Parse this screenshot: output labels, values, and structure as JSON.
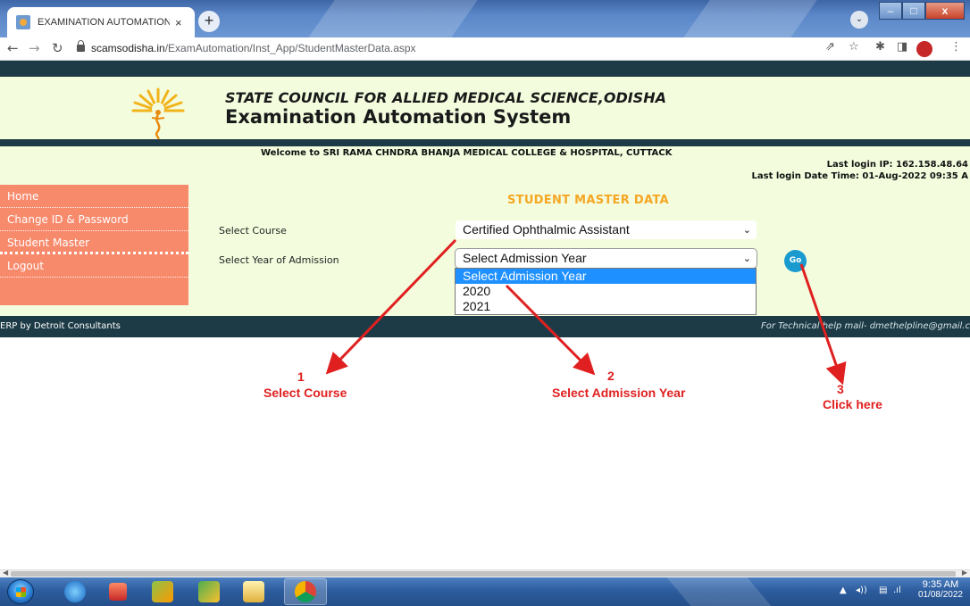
{
  "browser": {
    "tab_title": "EXAMINATION AUTOMATION SY",
    "tab_close": "×",
    "new_tab": "+",
    "url_host": "scamsodisha.in",
    "url_path": "/ExamAutomation/Inst_App/StudentMasterData.aspx"
  },
  "header": {
    "council": "STATE COUNCIL FOR ALLIED MEDICAL SCIENCE,ODISHA",
    "system": "Examination Automation System"
  },
  "welcome": {
    "text": "Welcome to  SRI RAMA CHNDRA BHANJA MEDICAL COLLEGE & HOSPITAL, CUTTACK",
    "last_ip": "Last login IP:  162.158.48.64",
    "last_datetime": "Last login Date Time: 01-Aug-2022 09:35 A"
  },
  "menu": {
    "items": [
      {
        "label": "Home"
      },
      {
        "label": "Change ID & Password"
      },
      {
        "label": "Student Master"
      },
      {
        "label": "Logout"
      }
    ]
  },
  "form": {
    "title": "STUDENT MASTER DATA",
    "course_label": "Select Course",
    "course_value": "Certified Ophthalmic Assistant",
    "year_label": "Select Year of Admission",
    "year_value": "Select Admission Year",
    "year_options": [
      "Select Admission Year",
      "2020",
      "2021"
    ],
    "go_label": "Go"
  },
  "footer": {
    "left": "ERP by Detroit Consultants",
    "right": "For Technical help mail- dmethelpline@gmail.c"
  },
  "annotations": [
    {
      "number": "1",
      "label": "Select Course"
    },
    {
      "number": "2",
      "label": "Select Admission Year"
    },
    {
      "number": "3",
      "label": "Click here"
    }
  ],
  "taskbar": {
    "time": "9:35 AM",
    "date": "01/08/2022"
  },
  "colors": {
    "header_bg": "#f3fdde",
    "dark_bar": "#1d3b46",
    "menu_bg": "#f88a6c",
    "title_color": "#f5a623",
    "annotation": "#e02020",
    "go_button": "#1a9bd0"
  }
}
